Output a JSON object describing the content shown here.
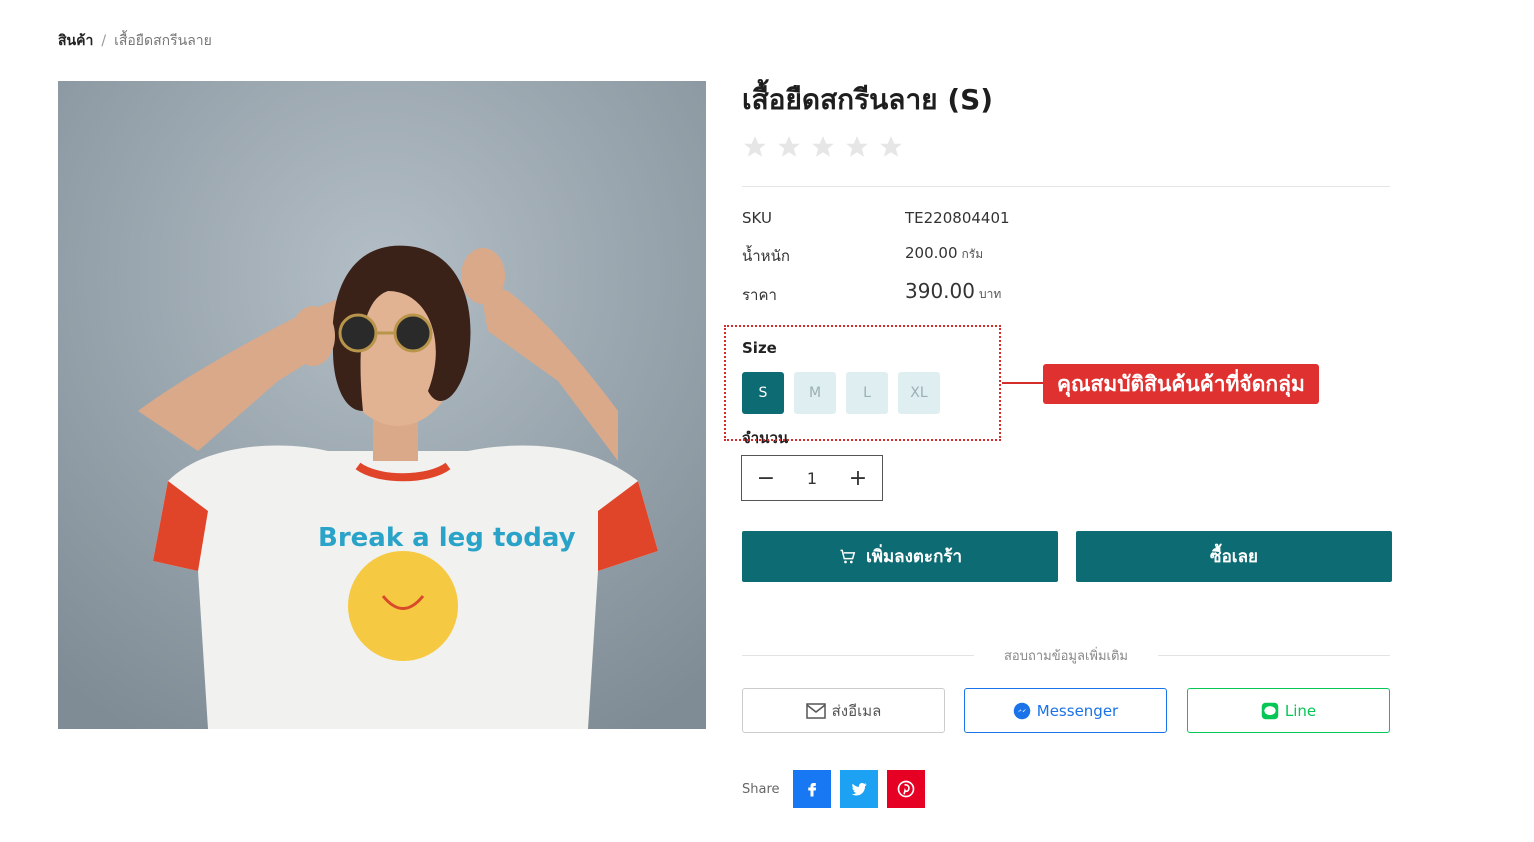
{
  "breadcrumb": {
    "home": "สินค้า",
    "separator": "/",
    "current": "เสื้อยืดสกรีนลาย"
  },
  "product": {
    "title": "เสื้อยืดสกรีนลาย (S)",
    "rating": {
      "value": 0,
      "max": 5
    },
    "sku_label": "SKU",
    "sku_value": "TE220804401",
    "weight_label": "น้ำหนัก",
    "weight_value": "200.00",
    "weight_unit": "กรัม",
    "price_label": "ราคา",
    "price_value": "390.00",
    "price_unit": "บาท"
  },
  "size": {
    "label": "Size",
    "options": [
      "S",
      "M",
      "L",
      "XL"
    ],
    "selected": "S"
  },
  "quantity": {
    "label": "จำนวน",
    "value": "1",
    "minus": "−",
    "plus": "+"
  },
  "actions": {
    "add_to_cart": "เพิ่มลงตะกร้า",
    "buy_now": "ซื้อเลย"
  },
  "inquiry": {
    "heading": "สอบถามข้อมูลเพิ่มเติม",
    "email": "ส่งอีเมล",
    "messenger": "Messenger",
    "line": "Line"
  },
  "share": {
    "label": "Share",
    "networks": [
      "facebook",
      "twitter",
      "pinterest"
    ]
  },
  "annotation": {
    "text": "คุณสมบัติสินค้นค้าที่จัดกลุ่ม"
  },
  "colors": {
    "primary": "#0d6b73",
    "size_inactive": "#dfeef1",
    "messenger": "#1a73e8",
    "line": "#06c755",
    "facebook": "#1877f2",
    "twitter": "#1da1f2",
    "pinterest": "#e60023",
    "annotation": "#e03131"
  }
}
